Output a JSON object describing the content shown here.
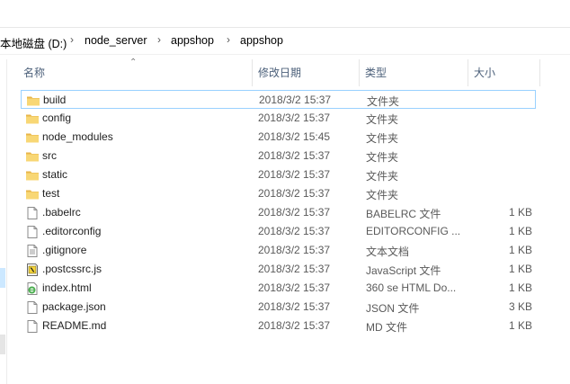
{
  "breadcrumb": [
    "本地磁盘 (D:)",
    "node_server",
    "appshop",
    "appshop"
  ],
  "columns": {
    "name": "名称",
    "modified": "修改日期",
    "type": "类型",
    "size": "大小"
  },
  "files": [
    {
      "name": "build",
      "date": "2018/3/2 15:37",
      "type": "文件夹",
      "size": "",
      "icon": "folder-icon"
    },
    {
      "name": "config",
      "date": "2018/3/2 15:37",
      "type": "文件夹",
      "size": "",
      "icon": "folder-icon"
    },
    {
      "name": "node_modules",
      "date": "2018/3/2 15:45",
      "type": "文件夹",
      "size": "",
      "icon": "folder-icon"
    },
    {
      "name": "src",
      "date": "2018/3/2 15:37",
      "type": "文件夹",
      "size": "",
      "icon": "folder-icon"
    },
    {
      "name": "static",
      "date": "2018/3/2 15:37",
      "type": "文件夹",
      "size": "",
      "icon": "folder-icon"
    },
    {
      "name": "test",
      "date": "2018/3/2 15:37",
      "type": "文件夹",
      "size": "",
      "icon": "folder-icon"
    },
    {
      "name": ".babelrc",
      "date": "2018/3/2 15:37",
      "type": "BABELRC 文件",
      "size": "1 KB",
      "icon": "file-icon"
    },
    {
      "name": ".editorconfig",
      "date": "2018/3/2 15:37",
      "type": "EDITORCONFIG ...",
      "size": "1 KB",
      "icon": "file-icon"
    },
    {
      "name": ".gitignore",
      "date": "2018/3/2 15:37",
      "type": "文本文档",
      "size": "1 KB",
      "icon": "text-file-icon"
    },
    {
      "name": ".postcssrc.js",
      "date": "2018/3/2 15:37",
      "type": "JavaScript 文件",
      "size": "1 KB",
      "icon": "javascript-file-icon"
    },
    {
      "name": "index.html",
      "date": "2018/3/2 15:37",
      "type": "360 se HTML Do...",
      "size": "1 KB",
      "icon": "html-file-icon"
    },
    {
      "name": "package.json",
      "date": "2018/3/2 15:37",
      "type": "JSON 文件",
      "size": "3 KB",
      "icon": "file-icon"
    },
    {
      "name": "README.md",
      "date": "2018/3/2 15:37",
      "type": "MD 文件",
      "size": "1 KB",
      "icon": "file-icon"
    }
  ],
  "colors": {
    "selection_border": "#99d1ff",
    "folder_yellow": "#f8d775",
    "header_text": "#4c607a"
  }
}
